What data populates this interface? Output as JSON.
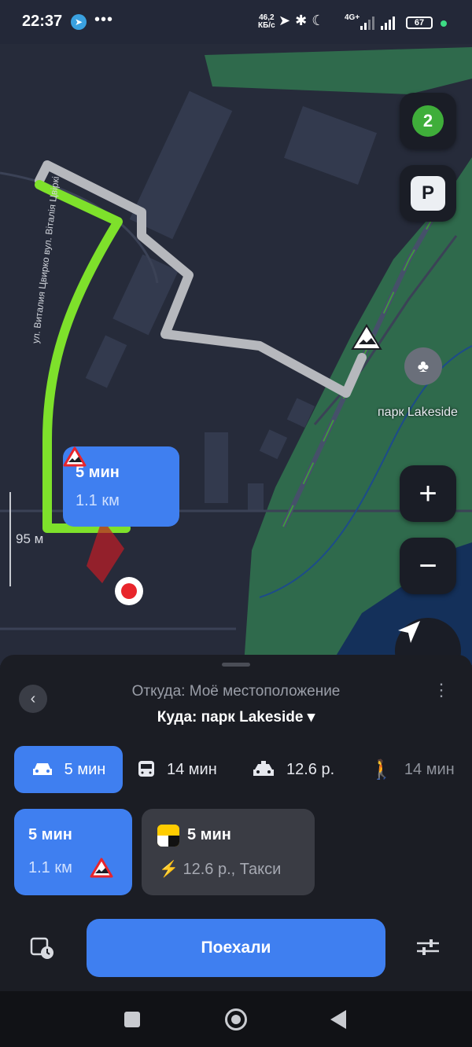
{
  "status_bar": {
    "time": "22:37",
    "more": "•••",
    "speed_value": "46,2",
    "speed_unit": "КБ/с",
    "network": "4G+",
    "battery": "67"
  },
  "map": {
    "traffic_level": "2",
    "parking_label": "P",
    "route_bubble": {
      "time": "5 мин",
      "distance": "1.1 км"
    },
    "park_label": "парк Lakeside",
    "scale": "95 м",
    "street_label": "ул. Виталия Цвирко  вул. Віталія Цвіркі",
    "zoom_in": "+",
    "zoom_out": "−"
  },
  "route_panel": {
    "from": "Откуда: Моё местоположение",
    "to": "Куда: парк Lakeside ▾",
    "modes": [
      {
        "icon": "car-icon",
        "label": "5 мин"
      },
      {
        "icon": "bus-icon",
        "label": "14 мин"
      },
      {
        "icon": "taxi-icon",
        "label": "12.6 р."
      },
      {
        "icon": "walk-icon",
        "label": "14 мин"
      }
    ],
    "route_card": {
      "time": "5 мин",
      "distance": "1.1 км"
    },
    "taxi_card": {
      "time": "5 мин",
      "price": "⚡ 12.6 р., Такси"
    },
    "go_label": "Поехали"
  },
  "colors": {
    "accent": "#3f7ff0",
    "route_green": "#7ee12b",
    "map_bg": "#262b3a",
    "park_green": "#2f6a4c"
  }
}
